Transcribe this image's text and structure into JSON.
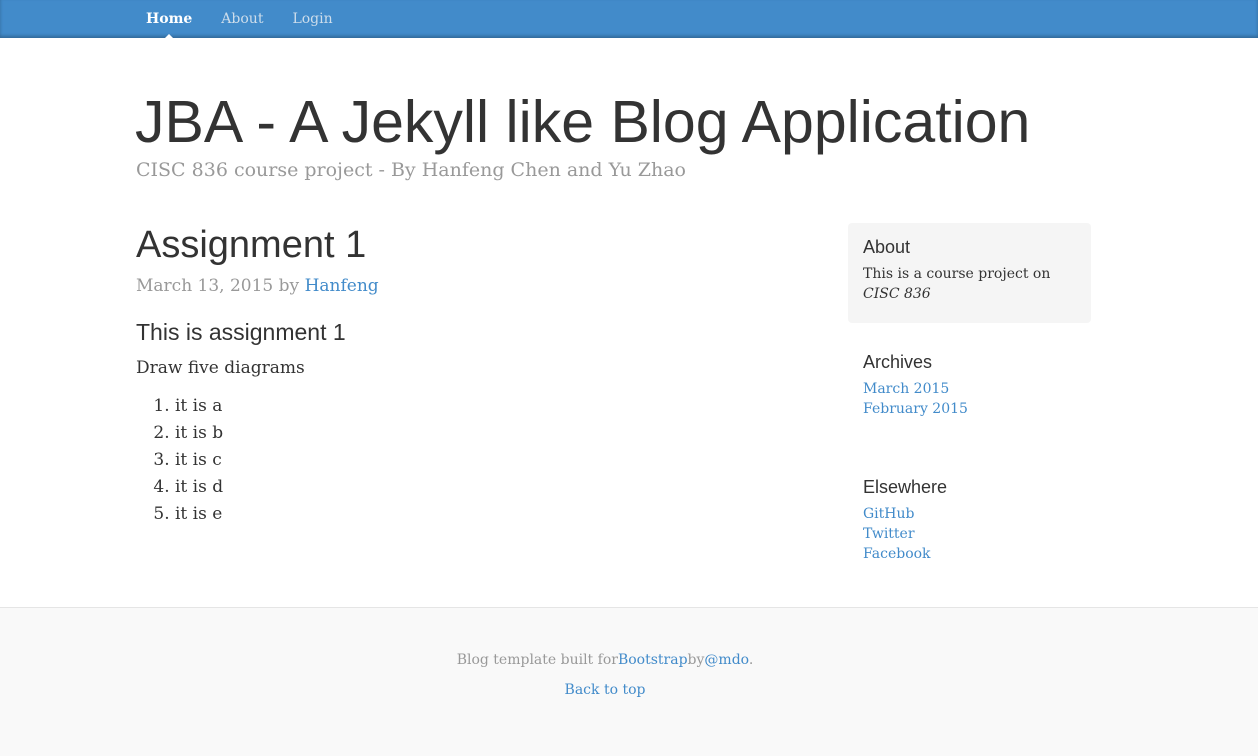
{
  "navbar": {
    "items": [
      {
        "label": "Home"
      },
      {
        "label": "About"
      },
      {
        "label": "Login"
      }
    ],
    "background": "#428bca"
  },
  "header": {
    "title": "JBA - A Jekyll like Blog Application",
    "description": "CISC 836 course project - By Hanfeng Chen and Yu Zhao"
  },
  "post": {
    "title": "Assignment 1",
    "date": "March 13, 2015",
    "by": "by",
    "author": "Hanfeng",
    "subtitle": "This is assignment 1",
    "text": "Draw five diagrams",
    "list": [
      "it is a",
      "it is b",
      "it is c",
      "it is d",
      "it is e"
    ]
  },
  "sidebar": {
    "about": {
      "heading": "About",
      "text_prefix": "This is a course project on ",
      "text_emphasis": "CISC 836"
    },
    "archives": {
      "heading": "Archives",
      "links": [
        "March 2015",
        "February 2015"
      ]
    },
    "elsewhere": {
      "heading": "Elsewhere",
      "links": [
        "GitHub",
        "Twitter",
        "Facebook"
      ]
    }
  },
  "footer": {
    "credits_prefix": "Blog template built for",
    "credits_link1": "Bootstrap",
    "credits_mid": "by",
    "credits_link2": "@mdo",
    "credits_suffix": ".",
    "back_to_top": "Back to top"
  },
  "colors": {
    "link": "#428bca",
    "muted": "#999999",
    "heading": "#333333"
  }
}
